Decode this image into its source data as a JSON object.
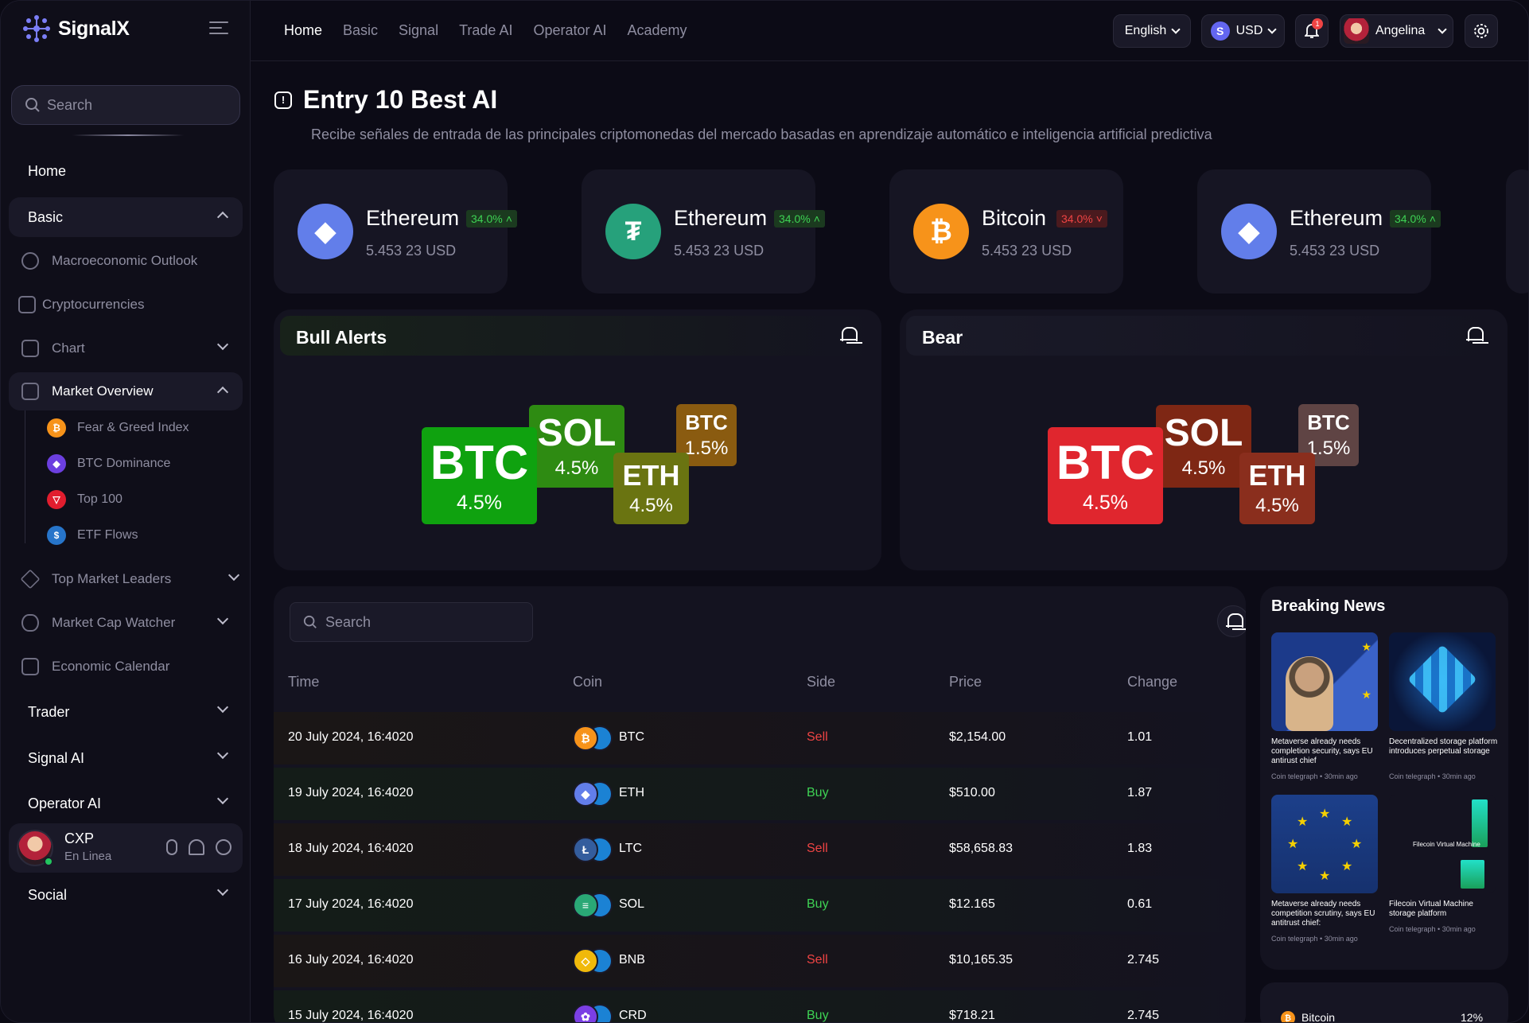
{
  "app": {
    "name": "SignalX"
  },
  "sidebar": {
    "search_placeholder": "Search",
    "home": "Home",
    "basic": "Basic",
    "basic_items": [
      "Macroeconomic Outlook",
      "Cryptocurrencies",
      "Chart",
      "Market Overview"
    ],
    "market_overview_items": [
      "Fear & Greed Index",
      "BTC Dominance",
      "Top 100",
      "ETF Flows"
    ],
    "more_items": [
      "Top Market Leaders",
      "Market Cap Watcher",
      "Economic Calendar"
    ],
    "sections": [
      "Trader",
      "Signal AI",
      "Operator AI"
    ],
    "user": {
      "name": "CXP",
      "status": "En Linea"
    },
    "social": "Social"
  },
  "header": {
    "nav": [
      "Home",
      "Basic",
      "Signal",
      "Trade AI",
      "Operator AI",
      "Academy"
    ],
    "language": "English",
    "currency": "USD",
    "currency_symbol": "S",
    "notif_count": "1",
    "user": "Angelina"
  },
  "page": {
    "title": "Entry 10 Best AI",
    "subtitle": "Recibe señales de entrada de las principales criptomonedas del mercado basadas en aprendizaje automático e inteligencia artificial predictiva"
  },
  "cards": [
    {
      "name": "Ethereum",
      "pct": "34.0%",
      "trend": "up",
      "price": "5.453 23 USD",
      "color": "#627eea",
      "glyph": "◆"
    },
    {
      "name": "Ethereum",
      "pct": "34.0%",
      "trend": "up",
      "price": "5.453 23 USD",
      "color": "#26a17b",
      "glyph": "₮"
    },
    {
      "name": "Bitcoin",
      "pct": "34.0%",
      "trend": "down",
      "price": "5.453 23 USD",
      "color": "#f7931a",
      "glyph": "₿"
    },
    {
      "name": "Ethereum",
      "pct": "34.0%",
      "trend": "up",
      "price": "5.453 23 USD",
      "color": "#627eea",
      "glyph": "◆"
    }
  ],
  "bull": {
    "title": "Bull Alerts",
    "tiles": [
      {
        "sym": "BTC",
        "pct": "4.5%",
        "color": "#0fa20f"
      },
      {
        "sym": "SOL",
        "pct": "4.5%",
        "color": "#2e8b12"
      },
      {
        "sym": "ETH",
        "pct": "4.5%",
        "color": "#6a7411"
      },
      {
        "sym": "BTC",
        "pct": "1.5%",
        "color": "#8a5b10"
      }
    ]
  },
  "bear": {
    "title": "Bear",
    "tiles": [
      {
        "sym": "BTC",
        "pct": "4.5%",
        "color": "#e0262e"
      },
      {
        "sym": "SOL",
        "pct": "4.5%",
        "color": "#7e2714"
      },
      {
        "sym": "ETH",
        "pct": "4.5%",
        "color": "#8a2e1d"
      },
      {
        "sym": "BTC",
        "pct": "1.5%",
        "color": "#5f4444"
      }
    ]
  },
  "table": {
    "search_placeholder": "Search",
    "headers": [
      "Time",
      "Coin",
      "Side",
      "Price",
      "Change"
    ],
    "rows": [
      {
        "time": "20 July 2024, 16:4020",
        "coin": "BTC",
        "side": "Sell",
        "price": "$2,154.00",
        "change": "1.01",
        "color": "#f7931a",
        "glyph": "₿"
      },
      {
        "time": "19 July 2024, 16:4020",
        "coin": "ETH",
        "side": "Buy",
        "price": "$510.00",
        "change": "1.87",
        "color": "#627eea",
        "glyph": "◆"
      },
      {
        "time": "18 July 2024, 16:4020",
        "coin": "LTC",
        "side": "Sell",
        "price": "$58,658.83",
        "change": "1.83",
        "color": "#345d9d",
        "glyph": "Ł"
      },
      {
        "time": "17 July 2024, 16:4020",
        "coin": "SOL",
        "side": "Buy",
        "price": "$12.165",
        "change": "0.61",
        "color": "#2aa876",
        "glyph": "≡"
      },
      {
        "time": "16 July 2024, 16:4020",
        "coin": "BNB",
        "side": "Sell",
        "price": "$10,165.35",
        "change": "2.745",
        "color": "#f0b90b",
        "glyph": "◇"
      },
      {
        "time": "15 July 2024, 16:4020",
        "coin": "CRD",
        "side": "Buy",
        "price": "$718.21",
        "change": "2.745",
        "color": "#7b3fe4",
        "glyph": "✿"
      }
    ]
  },
  "news": {
    "title": "Breaking News",
    "items": [
      {
        "caption": "Metaverse already needs completion security, says EU antirust chief",
        "source": "Coin telegraph • 30min ago"
      },
      {
        "caption": "Decentralized storage platform introduces perpetual storage",
        "source": "Coin telegraph • 30min ago"
      },
      {
        "caption": "Metaverse already needs competition scrutiny, says EU antitrust chief:",
        "source": "Coin telegraph • 30min ago"
      },
      {
        "caption": "Filecoin Virtual Machine storage platform",
        "source": "Coin telegraph • 30min ago"
      }
    ],
    "img_label": "Filecoin Virtual Machine"
  },
  "mini": {
    "name": "Bitcoin",
    "pct": "12%"
  }
}
